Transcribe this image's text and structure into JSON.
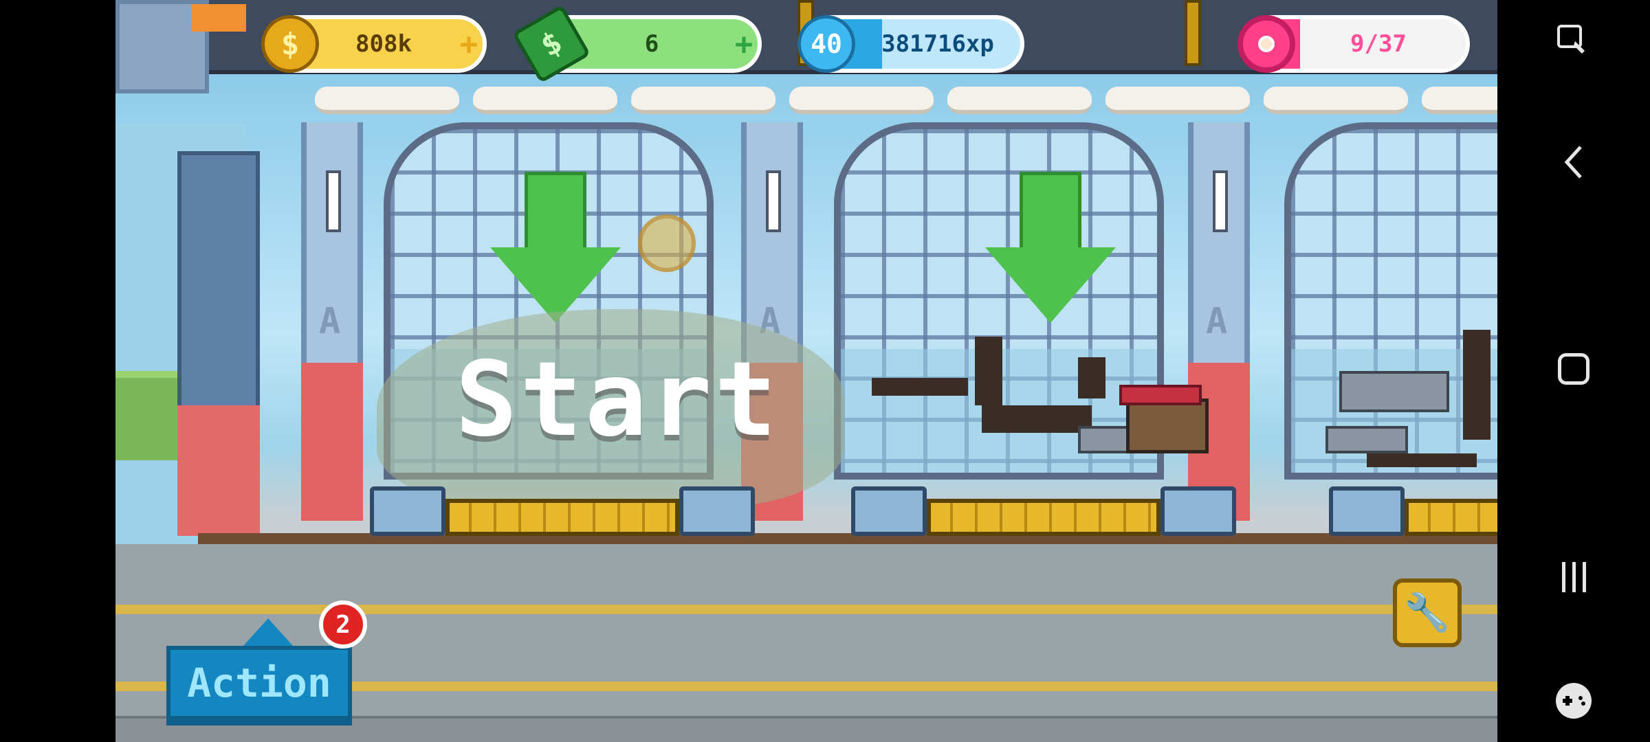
{
  "hud": {
    "coins": "808k",
    "cash": "6",
    "level": "40",
    "xp": "381716xp",
    "xp_fraction": 0.35,
    "donut_progress": "9/37",
    "donut_fraction": 0.243,
    "plus_symbol": "+"
  },
  "stage": {
    "start_label": "Start"
  },
  "controls": {
    "action_label": "Action",
    "action_badge": "2"
  },
  "colors": {
    "coin": "#f7d24a",
    "cash": "#57d160",
    "xp": "#2ba7e4",
    "donut": "#ff3f88"
  },
  "icons": {
    "coin": "dollar-coin-icon",
    "cash": "cash-bill-icon",
    "level": "star-level-icon",
    "donut": "donut-icon",
    "wrench": "wrench-icon"
  }
}
